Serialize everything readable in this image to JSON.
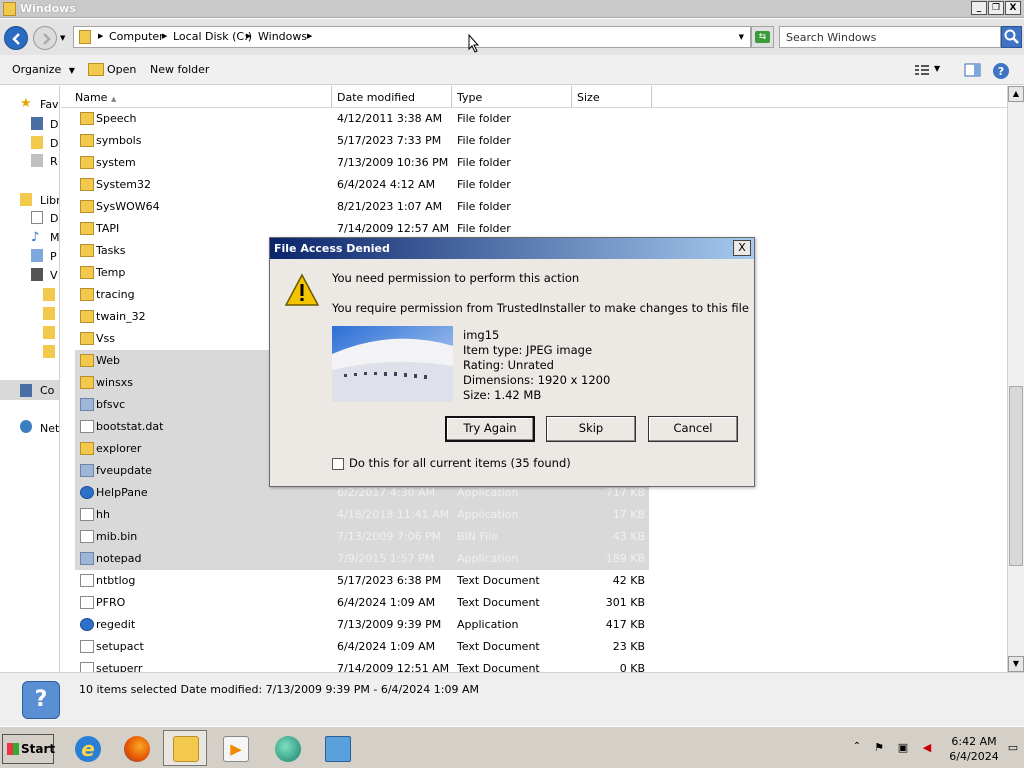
{
  "window": {
    "title": "Windows",
    "controls": {
      "minimize": "_",
      "restore": "❐",
      "close": "X"
    }
  },
  "address": {
    "crumbs": [
      "Computer",
      "Local Disk (C:)",
      "Windows"
    ],
    "search_placeholder": "Search Windows"
  },
  "toolbar": {
    "organize": "Organize",
    "open": "Open",
    "new_folder": "New folder"
  },
  "navpane": {
    "items": [
      "Fav",
      "D",
      "D",
      "R",
      "Libr",
      "D",
      "M",
      "P",
      "V",
      "Co",
      "Net"
    ]
  },
  "columns": {
    "name": "Name",
    "date_modified": "Date modified",
    "type": "Type",
    "size": "Size"
  },
  "files": [
    {
      "name": "Speech",
      "date": "4/12/2011 3:38 AM",
      "type": "File folder",
      "size": "",
      "kind": "folder",
      "selected": false
    },
    {
      "name": "symbols",
      "date": "5/17/2023 7:33 PM",
      "type": "File folder",
      "size": "",
      "kind": "folder",
      "selected": false
    },
    {
      "name": "system",
      "date": "7/13/2009 10:36 PM",
      "type": "File folder",
      "size": "",
      "kind": "folder",
      "selected": false
    },
    {
      "name": "System32",
      "date": "6/4/2024 4:12 AM",
      "type": "File folder",
      "size": "",
      "kind": "folder",
      "selected": false
    },
    {
      "name": "SysWOW64",
      "date": "8/21/2023 1:07 AM",
      "type": "File folder",
      "size": "",
      "kind": "folder",
      "selected": false
    },
    {
      "name": "TAPI",
      "date": "7/14/2009 12:57 AM",
      "type": "File folder",
      "size": "",
      "kind": "folder",
      "selected": false
    },
    {
      "name": "Tasks",
      "date": "",
      "type": "",
      "size": "",
      "kind": "folder",
      "selected": false
    },
    {
      "name": "Temp",
      "date": "",
      "type": "",
      "size": "",
      "kind": "folder",
      "selected": false
    },
    {
      "name": "tracing",
      "date": "",
      "type": "",
      "size": "",
      "kind": "folder",
      "selected": false
    },
    {
      "name": "twain_32",
      "date": "",
      "type": "",
      "size": "",
      "kind": "folder",
      "selected": false
    },
    {
      "name": "Vss",
      "date": "",
      "type": "",
      "size": "",
      "kind": "folder",
      "selected": false
    },
    {
      "name": "Web",
      "date": "",
      "type": "",
      "size": "",
      "kind": "folder",
      "selected": true
    },
    {
      "name": "winsxs",
      "date": "",
      "type": "",
      "size": "",
      "kind": "folder",
      "selected": true
    },
    {
      "name": "bfsvc",
      "date": "",
      "type": "",
      "size": "",
      "kind": "img",
      "selected": true
    },
    {
      "name": "bootstat.dat",
      "date": "",
      "type": "",
      "size": "",
      "kind": "file",
      "selected": true
    },
    {
      "name": "explorer",
      "date": "",
      "type": "",
      "size": "",
      "kind": "folder",
      "selected": true
    },
    {
      "name": "fveupdate",
      "date": "",
      "type": "",
      "size": "",
      "kind": "img",
      "selected": true
    },
    {
      "name": "HelpPane",
      "date": "6/2/2017 4:30 AM",
      "type": "Application",
      "size": "717 KB",
      "kind": "app",
      "selected": true
    },
    {
      "name": "hh",
      "date": "4/18/2018 11:41 AM",
      "type": "Application",
      "size": "17 KB",
      "kind": "file",
      "selected": true
    },
    {
      "name": "mib.bin",
      "date": "7/13/2009 7:06 PM",
      "type": "BIN File",
      "size": "43 KB",
      "kind": "file",
      "selected": true
    },
    {
      "name": "notepad",
      "date": "7/9/2015 1:57 PM",
      "type": "Application",
      "size": "189 KB",
      "kind": "img",
      "selected": true
    },
    {
      "name": "ntbtlog",
      "date": "5/17/2023 6:38 PM",
      "type": "Text Document",
      "size": "42 KB",
      "kind": "file",
      "selected": false
    },
    {
      "name": "PFRO",
      "date": "6/4/2024 1:09 AM",
      "type": "Text Document",
      "size": "301 KB",
      "kind": "file",
      "selected": false
    },
    {
      "name": "regedit",
      "date": "7/13/2009 9:39 PM",
      "type": "Application",
      "size": "417 KB",
      "kind": "app",
      "selected": false
    },
    {
      "name": "setupact",
      "date": "6/4/2024 1:09 AM",
      "type": "Text Document",
      "size": "23 KB",
      "kind": "file",
      "selected": false
    },
    {
      "name": "setuperr",
      "date": "7/14/2009 12:51 AM",
      "type": "Text Document",
      "size": "0 KB",
      "kind": "file",
      "selected": false
    }
  ],
  "details": {
    "text": "10 items selected  Date modified: 7/13/2009 9:39 PM - 6/4/2024 1:09 AM"
  },
  "dialog": {
    "title": "File Access Denied",
    "close": "X",
    "message1": "You need permission to perform this action",
    "message2": "You require permission from TrustedInstaller to make changes to this file",
    "item_name": "img15",
    "item_type": "Item type: JPEG image",
    "rating": "Rating: Unrated",
    "dimensions": "Dimensions: 1920 x 1200",
    "size": "Size: 1.42 MB",
    "try_again": "Try Again",
    "skip": "Skip",
    "cancel": "Cancel",
    "checkbox_label": "Do this for all current items (35 found)",
    "checkbox_checked": false
  },
  "taskbar": {
    "start": "Start",
    "apps": [
      "internet-explorer-icon",
      "firefox-icon",
      "file-explorer-icon",
      "media-player-icon",
      "messenger-icon",
      "setup-icon"
    ],
    "clock_time": "6:42 AM",
    "clock_date": "6/4/2024"
  }
}
